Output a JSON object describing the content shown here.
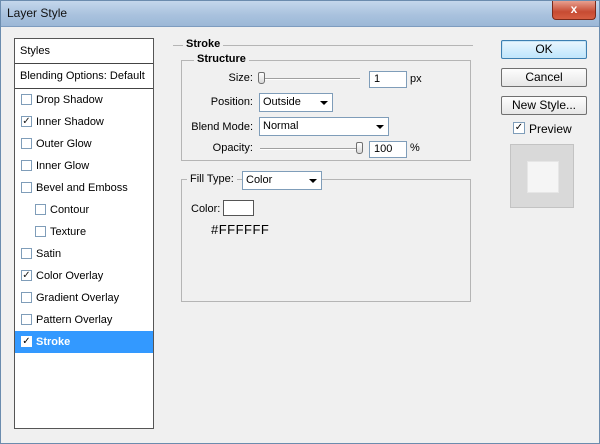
{
  "window": {
    "title": "Layer Style",
    "close_label": "x"
  },
  "styles_panel": {
    "header": "Styles",
    "blending": "Blending Options: Default",
    "items": [
      {
        "label": "Drop Shadow",
        "checked": false,
        "sub": false,
        "selected": false
      },
      {
        "label": "Inner Shadow",
        "checked": true,
        "sub": false,
        "selected": false
      },
      {
        "label": "Outer Glow",
        "checked": false,
        "sub": false,
        "selected": false
      },
      {
        "label": "Inner Glow",
        "checked": false,
        "sub": false,
        "selected": false
      },
      {
        "label": "Bevel and Emboss",
        "checked": false,
        "sub": false,
        "selected": false
      },
      {
        "label": "Contour",
        "checked": false,
        "sub": true,
        "selected": false
      },
      {
        "label": "Texture",
        "checked": false,
        "sub": true,
        "selected": false
      },
      {
        "label": "Satin",
        "checked": false,
        "sub": false,
        "selected": false
      },
      {
        "label": "Color Overlay",
        "checked": true,
        "sub": false,
        "selected": false
      },
      {
        "label": "Gradient Overlay",
        "checked": false,
        "sub": false,
        "selected": false
      },
      {
        "label": "Pattern Overlay",
        "checked": false,
        "sub": false,
        "selected": false
      },
      {
        "label": "Stroke",
        "checked": true,
        "sub": false,
        "selected": true
      }
    ]
  },
  "stroke": {
    "title": "Stroke",
    "structure": {
      "title": "Structure",
      "size_label": "Size:",
      "size_value": "1",
      "size_unit": "px",
      "position_label": "Position:",
      "position_value": "Outside",
      "blend_mode_label": "Blend Mode:",
      "blend_mode_value": "Normal",
      "opacity_label": "Opacity:",
      "opacity_value": "100",
      "opacity_unit": "%"
    },
    "fill": {
      "fill_type_label": "Fill Type:",
      "fill_type_value": "Color",
      "color_label": "Color:",
      "color_hex": "#FFFFFF"
    }
  },
  "buttons": {
    "ok": "OK",
    "cancel": "Cancel",
    "new_style": "New Style...",
    "preview_label": "Preview",
    "preview_checked": true
  },
  "check_mark": "✓"
}
